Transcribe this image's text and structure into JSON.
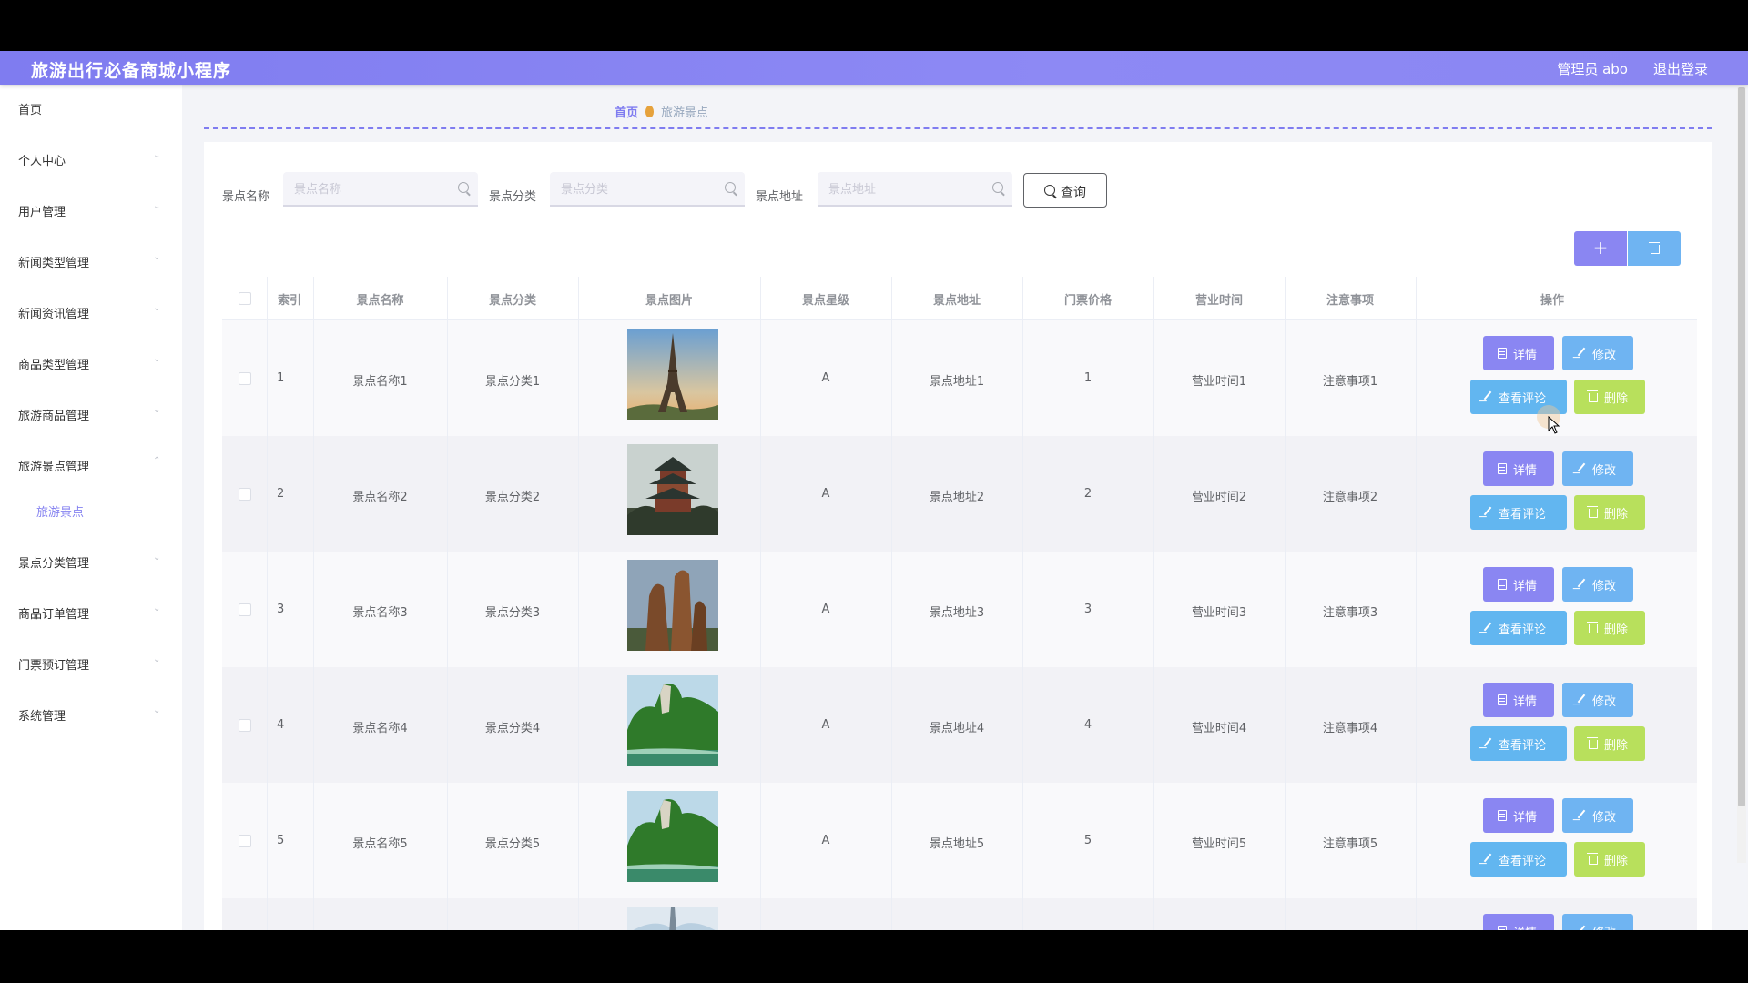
{
  "app": {
    "title": "旅游出行必备商城小程序",
    "admin_label": "管理员 abo",
    "logout_label": "退出登录"
  },
  "sidebar": {
    "items": [
      {
        "label": "首页",
        "has_arrow": false
      },
      {
        "label": "个人中心",
        "has_arrow": true
      },
      {
        "label": "用户管理",
        "has_arrow": true
      },
      {
        "label": "新闻类型管理",
        "has_arrow": true
      },
      {
        "label": "新闻资讯管理",
        "has_arrow": true
      },
      {
        "label": "商品类型管理",
        "has_arrow": true
      },
      {
        "label": "旅游商品管理",
        "has_arrow": true
      },
      {
        "label": "旅游景点管理",
        "has_arrow": true,
        "expanded": true
      },
      {
        "label": "景点分类管理",
        "has_arrow": true
      },
      {
        "label": "商品订单管理",
        "has_arrow": true
      },
      {
        "label": "门票预订管理",
        "has_arrow": true
      },
      {
        "label": "系统管理",
        "has_arrow": true
      }
    ],
    "active_subitem": "旅游景点"
  },
  "breadcrumb": {
    "home": "首页",
    "current": "旅游景点"
  },
  "search": {
    "fields": [
      {
        "label": "景点名称",
        "placeholder": "景点名称"
      },
      {
        "label": "景点分类",
        "placeholder": "景点分类"
      },
      {
        "label": "景点地址",
        "placeholder": "景点地址"
      }
    ],
    "query_label": "查询"
  },
  "toolbar": {
    "add_label": "+"
  },
  "table": {
    "headers": [
      "索引",
      "景点名称",
      "景点分类",
      "景点图片",
      "景点星级",
      "景点地址",
      "门票价格",
      "营业时间",
      "注意事项",
      "操作"
    ],
    "rows": [
      {
        "index": "1",
        "name": "景点名称1",
        "category": "景点分类1",
        "image": "eiffel-tower",
        "stars": "A",
        "address": "景点地址1",
        "price": "1",
        "hours": "营业时间1",
        "notes": "注意事项1"
      },
      {
        "index": "2",
        "name": "景点名称2",
        "category": "景点分类2",
        "image": "pagoda-pavilion",
        "stars": "A",
        "address": "景点地址2",
        "price": "2",
        "hours": "营业时间2",
        "notes": "注意事项2"
      },
      {
        "index": "3",
        "name": "景点名称3",
        "category": "景点分类3",
        "image": "rock-pillars",
        "stars": "A",
        "address": "景点地址3",
        "price": "3",
        "hours": "营业时间3",
        "notes": "注意事项3"
      },
      {
        "index": "4",
        "name": "景点名称4",
        "category": "景点分类4",
        "image": "green-mountain-river",
        "stars": "A",
        "address": "景点地址4",
        "price": "4",
        "hours": "营业时间4",
        "notes": "注意事项4"
      },
      {
        "index": "5",
        "name": "景点名称5",
        "category": "景点分类5",
        "image": "green-mountain-river",
        "stars": "A",
        "address": "景点地址5",
        "price": "5",
        "hours": "营业时间5",
        "notes": "注意事项5"
      },
      {
        "image": "snowy-tower",
        "partial": true
      }
    ],
    "actions": {
      "detail": "详情",
      "edit": "修改",
      "comments": "查看评论",
      "delete": "删除"
    }
  },
  "colors": {
    "primary": "#7f7cf0",
    "detail_button": "#8a86f2",
    "edit_button": "#6fb4f2",
    "comment_button": "#62b6f0",
    "delete_button": "#b8e05c"
  }
}
